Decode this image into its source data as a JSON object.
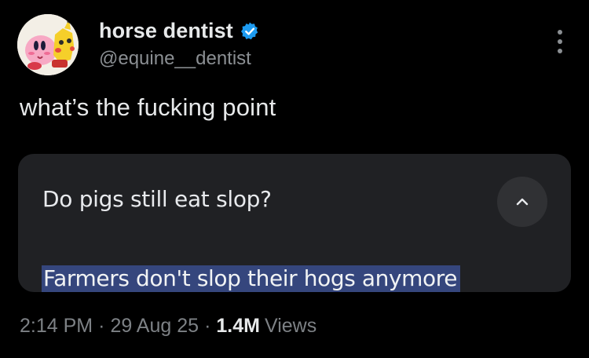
{
  "author": {
    "display_name": "horse dentist",
    "handle": "@equine__dentist",
    "verified": true,
    "avatar_icon": "kirby-pikachu-avatar"
  },
  "tweet": {
    "text": "what’s the fucking point"
  },
  "card": {
    "question": "Do pigs still eat slop?",
    "answer": "Farmers don't slop their hogs anymore",
    "expanded": true,
    "highlight_color": "#35467d"
  },
  "meta": {
    "time": "2:14 PM",
    "date": "29 Aug 25",
    "views_count": "1.4M",
    "views_label": "Views",
    "separator": "·"
  },
  "colors": {
    "background": "#000000",
    "primary_text": "#e7e9ea",
    "secondary_text": "#8b8f93",
    "verified_blue": "#1d9bf0",
    "card_background": "#202124"
  }
}
